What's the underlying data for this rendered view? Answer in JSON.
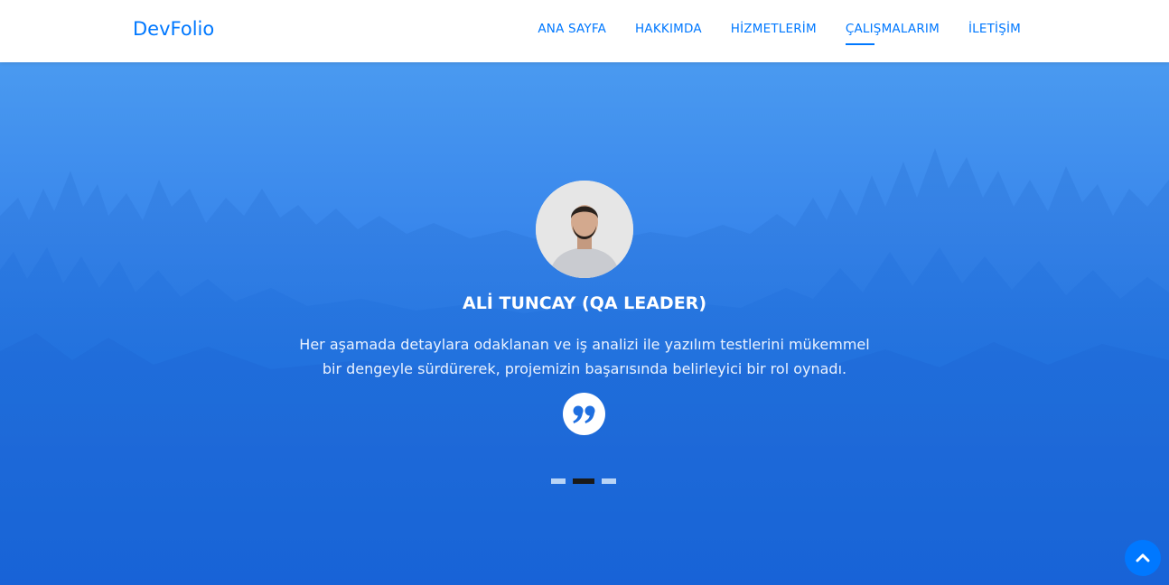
{
  "brand": "DevFolio",
  "nav": [
    {
      "label": "ANA SAYFA",
      "active": false
    },
    {
      "label": "HAKKIMDA",
      "active": false
    },
    {
      "label": "HİZMETLERİM",
      "active": false
    },
    {
      "label": "ÇALIŞMALARIM",
      "active": true
    },
    {
      "label": "İLETİŞİM",
      "active": false
    }
  ],
  "testimonial": {
    "name": "ALİ TUNCAY (QA LEADER)",
    "text": "Her aşamada detaylara odaklanan ve iş analizi ile yazılım testlerini mükemmel bir dengeyle sürdürerek, projemizin başarısında belirleyici bir rol oynadı.",
    "quote_icon": "quote-icon"
  },
  "carousel": {
    "count": 3,
    "active_index": 1
  },
  "back_to_top_icon": "chevron-up-icon",
  "colors": {
    "accent": "#0078ff",
    "hero_top": "#4a9af0",
    "hero_bottom": "#1866dc"
  }
}
